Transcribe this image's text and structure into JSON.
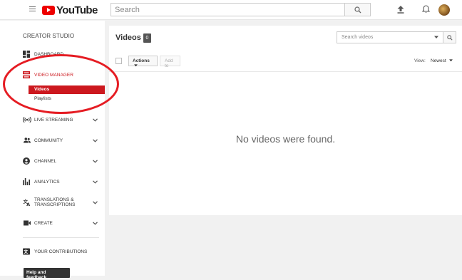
{
  "header": {
    "logo_text": "YouTube",
    "search_placeholder": "Search"
  },
  "sidebar": {
    "section_title": "CREATOR STUDIO",
    "items": [
      {
        "label": "DASHBOARD",
        "icon": "dashboard-icon"
      },
      {
        "label": "VIDEO MANAGER",
        "icon": "video-manager-icon",
        "active": true
      },
      {
        "label": "LIVE STREAMING",
        "icon": "live-streaming-icon"
      },
      {
        "label": "COMMUNITY",
        "icon": "community-icon"
      },
      {
        "label": "CHANNEL",
        "icon": "channel-icon"
      },
      {
        "label": "ANALYTICS",
        "icon": "analytics-icon"
      },
      {
        "label": "TRANSLATIONS & TRANSCRIPTIONS",
        "icon": "translate-icon"
      },
      {
        "label": "CREATE",
        "icon": "create-icon"
      }
    ],
    "sub_items": [
      {
        "label": "Videos",
        "selected": true
      },
      {
        "label": "Playlists"
      }
    ],
    "contributions_label": "YOUR CONTRIBUTIONS",
    "help_label": "Help and feedback"
  },
  "main": {
    "title": "Videos",
    "count": "0",
    "search_placeholder": "Search videos",
    "actions_label": "Actions",
    "add_to_label": "Add to",
    "view_label": "View:",
    "view_value": "Newest",
    "empty_message": "No videos were found."
  },
  "colors": {
    "brand_red": "#cc181e",
    "annotation_red": "#e51c23"
  }
}
